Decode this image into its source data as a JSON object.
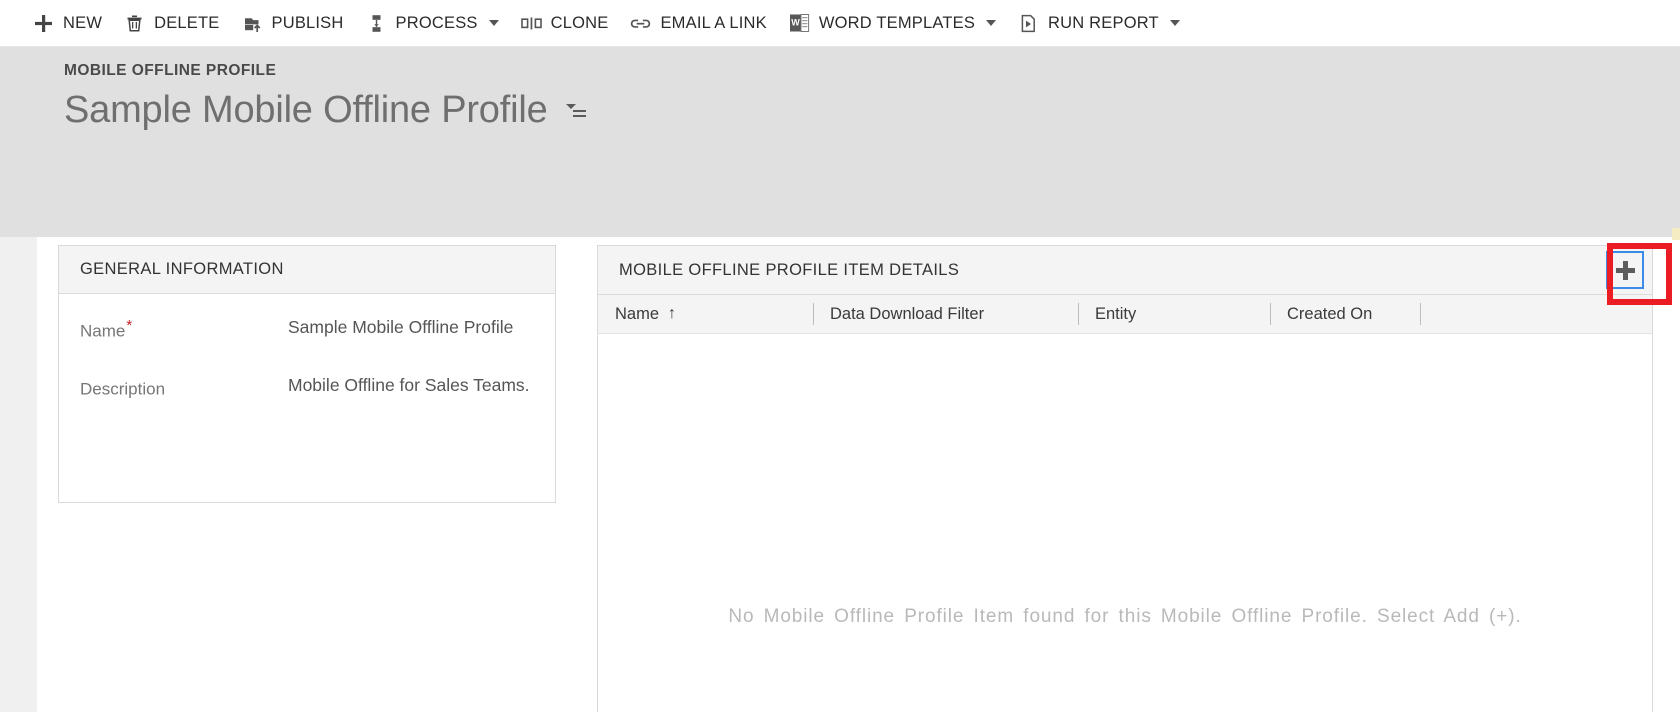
{
  "commandbar": {
    "buttons": [
      {
        "id": "new",
        "label": "NEW",
        "icon": "plus-icon",
        "caret": false
      },
      {
        "id": "delete",
        "label": "DELETE",
        "icon": "trash-icon",
        "caret": false
      },
      {
        "id": "publish",
        "label": "PUBLISH",
        "icon": "publish-upload-icon",
        "caret": false
      },
      {
        "id": "process",
        "label": "PROCESS",
        "icon": "process-icon",
        "caret": true
      },
      {
        "id": "clone",
        "label": "CLONE",
        "icon": "clone-icon",
        "caret": false
      },
      {
        "id": "email-a-link",
        "label": "EMAIL A LINK",
        "icon": "link-icon",
        "caret": false
      },
      {
        "id": "word-templates",
        "label": "WORD TEMPLATES",
        "icon": "word-document-icon",
        "caret": true
      },
      {
        "id": "run-report",
        "label": "RUN REPORT",
        "icon": "report-icon",
        "caret": true
      }
    ]
  },
  "header": {
    "entity_type": "MOBILE OFFLINE PROFILE",
    "record_title": "Sample Mobile Offline Profile",
    "title_menu_icon": "record-set-navigator-icon"
  },
  "general_information": {
    "section_title": "GENERAL INFORMATION",
    "fields": [
      {
        "label": "Name",
        "required": true,
        "required_marker": "*",
        "value": "Sample Mobile Offline Profile"
      },
      {
        "label": "Description",
        "required": false,
        "required_marker": "",
        "value": "Mobile Offline for Sales Teams."
      }
    ]
  },
  "item_details_grid": {
    "section_title": "MOBILE OFFLINE PROFILE ITEM DETAILS",
    "add_button": {
      "label": "+",
      "icon": "plus-icon",
      "tooltip": "Add"
    },
    "columns": [
      {
        "label": "Name",
        "sorted": true,
        "sort_arrow": "↑"
      },
      {
        "label": "Data Download Filter",
        "sorted": false,
        "sort_arrow": ""
      },
      {
        "label": "Entity",
        "sorted": false,
        "sort_arrow": ""
      },
      {
        "label": "Created On",
        "sorted": false,
        "sort_arrow": ""
      }
    ],
    "rows": [],
    "empty_message": "No Mobile Offline Profile Item found for this Mobile Offline Profile. Select Add (+)."
  },
  "colors": {
    "header_band": "#e0e0e0",
    "section_header": "#f4f4f4",
    "accent_blue": "#3b8ce8",
    "highlight_red": "#ec1c24",
    "required_red": "#cc2026",
    "text_primary": "#333333",
    "text_muted": "#767676",
    "empty_text": "#b9b9b9"
  }
}
